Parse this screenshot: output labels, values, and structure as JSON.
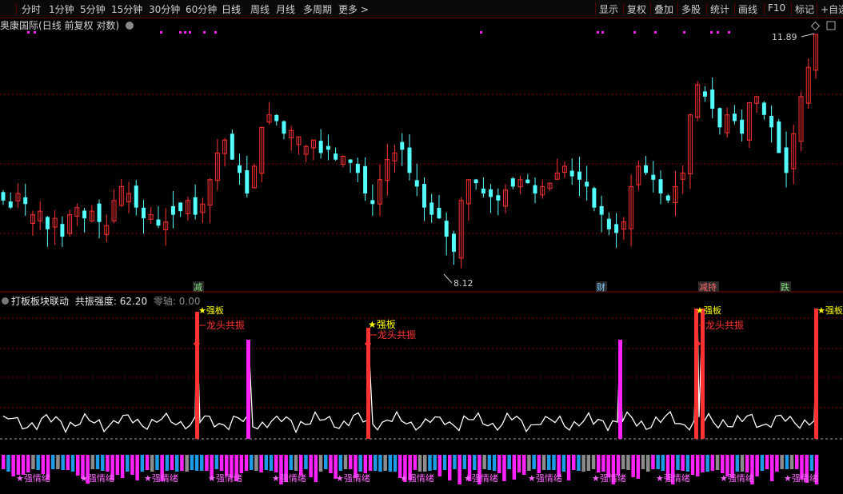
{
  "toolbar": {
    "periods": [
      "分时",
      "1分钟",
      "5分钟",
      "15分钟",
      "30分钟",
      "60分钟",
      "日线",
      "周线",
      "月线",
      "多周期",
      "更多 >"
    ],
    "active_period": "日线",
    "right_tools": [
      "显示",
      "复权",
      "叠加",
      "多股",
      "统计",
      "画线",
      "F10",
      "标记",
      "+自选"
    ]
  },
  "stock": {
    "name": "奥康国际",
    "mode": "(日线 前复权 对数)",
    "price_high_label": "11.89",
    "price_low_label": "8.12"
  },
  "event_tags": [
    "减",
    "财",
    "减持",
    "跌"
  ],
  "indicator": {
    "name": "打板板块联动",
    "param_label": "共振强度:",
    "param_value": "62.20",
    "zero_label": "零轴:",
    "zero_value": "0.00",
    "signal_strong": "★强板",
    "signal_resonance": "龙头共振",
    "signal_strong_clipped": "★强板",
    "bottom_label": "★强情绪"
  },
  "colors": {
    "up": "#ff3232",
    "down": "#54ffff",
    "grid": "#8b0000",
    "magenta": "#ff22ff",
    "blue": "#1e9be6",
    "gray": "#8c8c8c",
    "yellow": "#ffff00"
  },
  "chart_data": {
    "type": "candlestick",
    "scale": "log",
    "price_range_visible": [
      8.12,
      11.89
    ],
    "candles_note": "daily OHLC shown, approximated",
    "closes": [
      9.2,
      9.1,
      9.3,
      9.15,
      9.0,
      9.05,
      8.8,
      8.95,
      8.7,
      9.0,
      9.1,
      8.95,
      9.05,
      8.9,
      8.85,
      9.2,
      9.4,
      9.3,
      9.1,
      8.95,
      9.0,
      8.85,
      8.9,
      9.0,
      9.05,
      9.2,
      9.0,
      9.15,
      9.5,
      9.9,
      10.1,
      9.8,
      9.6,
      9.3,
      9.7,
      10.3,
      10.5,
      10.4,
      10.2,
      10.25,
      10.15,
      10.0,
      10.1,
      9.9,
      9.95,
      9.8,
      9.85,
      9.75,
      9.6,
      9.3,
      9.15,
      9.5,
      9.8,
      9.9,
      9.95,
      9.6,
      9.4,
      9.1,
      9.0,
      8.95,
      8.7,
      8.5,
      9.2,
      9.5,
      9.45,
      9.3,
      9.25,
      9.2,
      9.35,
      9.4,
      9.5,
      9.45,
      9.3,
      9.4,
      9.45,
      9.6,
      9.7,
      9.55,
      9.5,
      9.4,
      9.1,
      9.0,
      8.8,
      8.75,
      8.9,
      9.4,
      9.7,
      9.6,
      9.5,
      9.3,
      9.2,
      9.4,
      9.6,
      10.5,
      11.0,
      10.8,
      10.6,
      10.3,
      10.5,
      10.4,
      10.2,
      10.7,
      10.8,
      10.5,
      10.3,
      9.9,
      9.6,
      10.2,
      10.8,
      11.3,
      11.89
    ]
  },
  "indicator_data": {
    "baseline_values_note": "white line oscillates near baseline with spikes at signal days",
    "signal_days_red": [
      40,
      73,
      128,
      129,
      150
    ],
    "signal_days_magenta": [
      50,
      120
    ]
  }
}
